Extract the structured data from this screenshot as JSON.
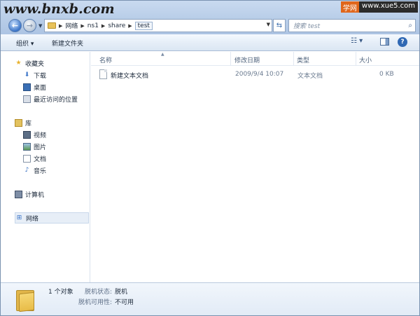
{
  "watermarks": {
    "left": "www.bnxb.com",
    "right_a": "学网",
    "right_b": "www.xue5.com"
  },
  "address": {
    "segments": [
      "网络",
      "ns1",
      "share",
      "test"
    ]
  },
  "search": {
    "placeholder": "搜索 test"
  },
  "toolbar": {
    "organize": "组织 ▾",
    "new_folder": "新建文件夹"
  },
  "nav": {
    "favorites": "收藏夹",
    "downloads": "下载",
    "desktop": "桌面",
    "recent": "最近访问的位置",
    "libraries": "库",
    "videos": "视频",
    "pictures": "图片",
    "documents": "文档",
    "music": "音乐",
    "computer": "计算机",
    "network": "网络"
  },
  "columns": {
    "name": "名称",
    "date": "修改日期",
    "type": "类型",
    "size": "大小"
  },
  "files": [
    {
      "name": "新建文本文档",
      "date": "2009/9/4 10:07",
      "type": "文本文档",
      "size": "0 KB"
    }
  ],
  "details": {
    "count": "1 个对象",
    "offline_status_label": "脱机状态:",
    "offline_status_value": "脱机",
    "offline_avail_label": "脱机可用性:",
    "offline_avail_value": "不可用"
  },
  "colors": {
    "chrome": "#b8cde8",
    "accent": "#3a74c8",
    "watermark_orange": "#e0661b"
  }
}
